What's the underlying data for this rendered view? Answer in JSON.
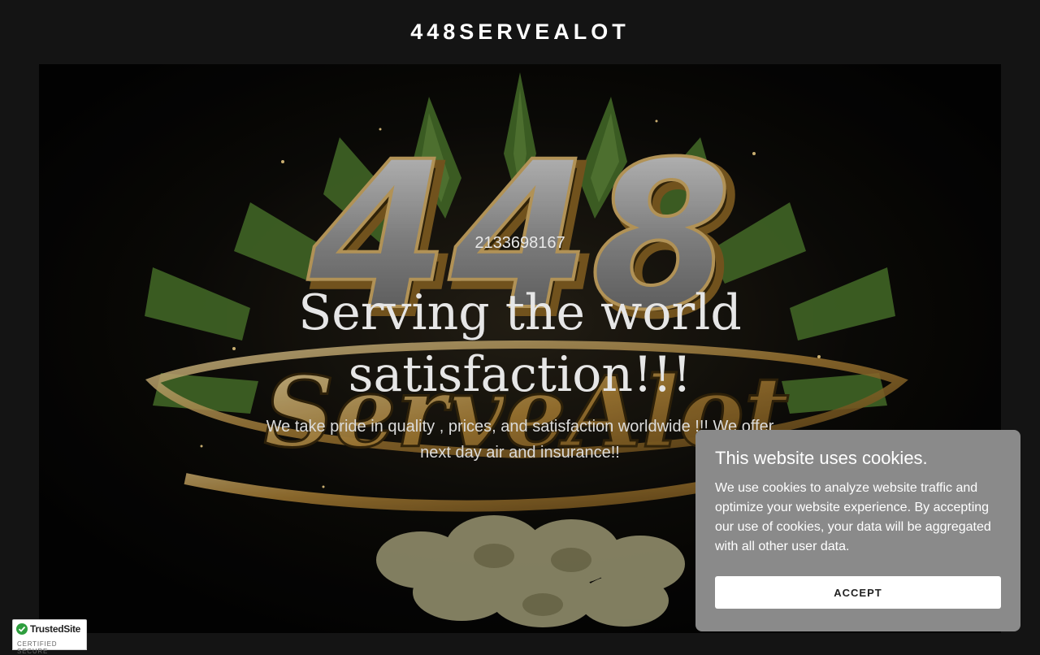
{
  "header": {
    "site_title": "448SERVEALOT"
  },
  "hero": {
    "background_art": "448 ServeAlot logo with cannabis leaves",
    "phone": "2133698167",
    "headline": "Serving the world satisfaction!!!",
    "subtext": "We take pride  in quality , prices, and satisfaction worldwide !!! We offer next day air and insurance!!"
  },
  "cookie_banner": {
    "title": "This website uses cookies.",
    "text": "We use cookies to analyze website traffic and optimize your website experience. By accepting our use of cookies, your data will be aggregated with all other user data.",
    "accept_label": "ACCEPT"
  },
  "trusted_badge": {
    "name": "TrustedSite",
    "subtitle": "CERTIFIED SECURE",
    "icon": "checkmark-icon"
  },
  "colors": {
    "page_background": "#141414",
    "cookie_background": "#8a8a8a",
    "badge_check": "#2e9e3e"
  }
}
